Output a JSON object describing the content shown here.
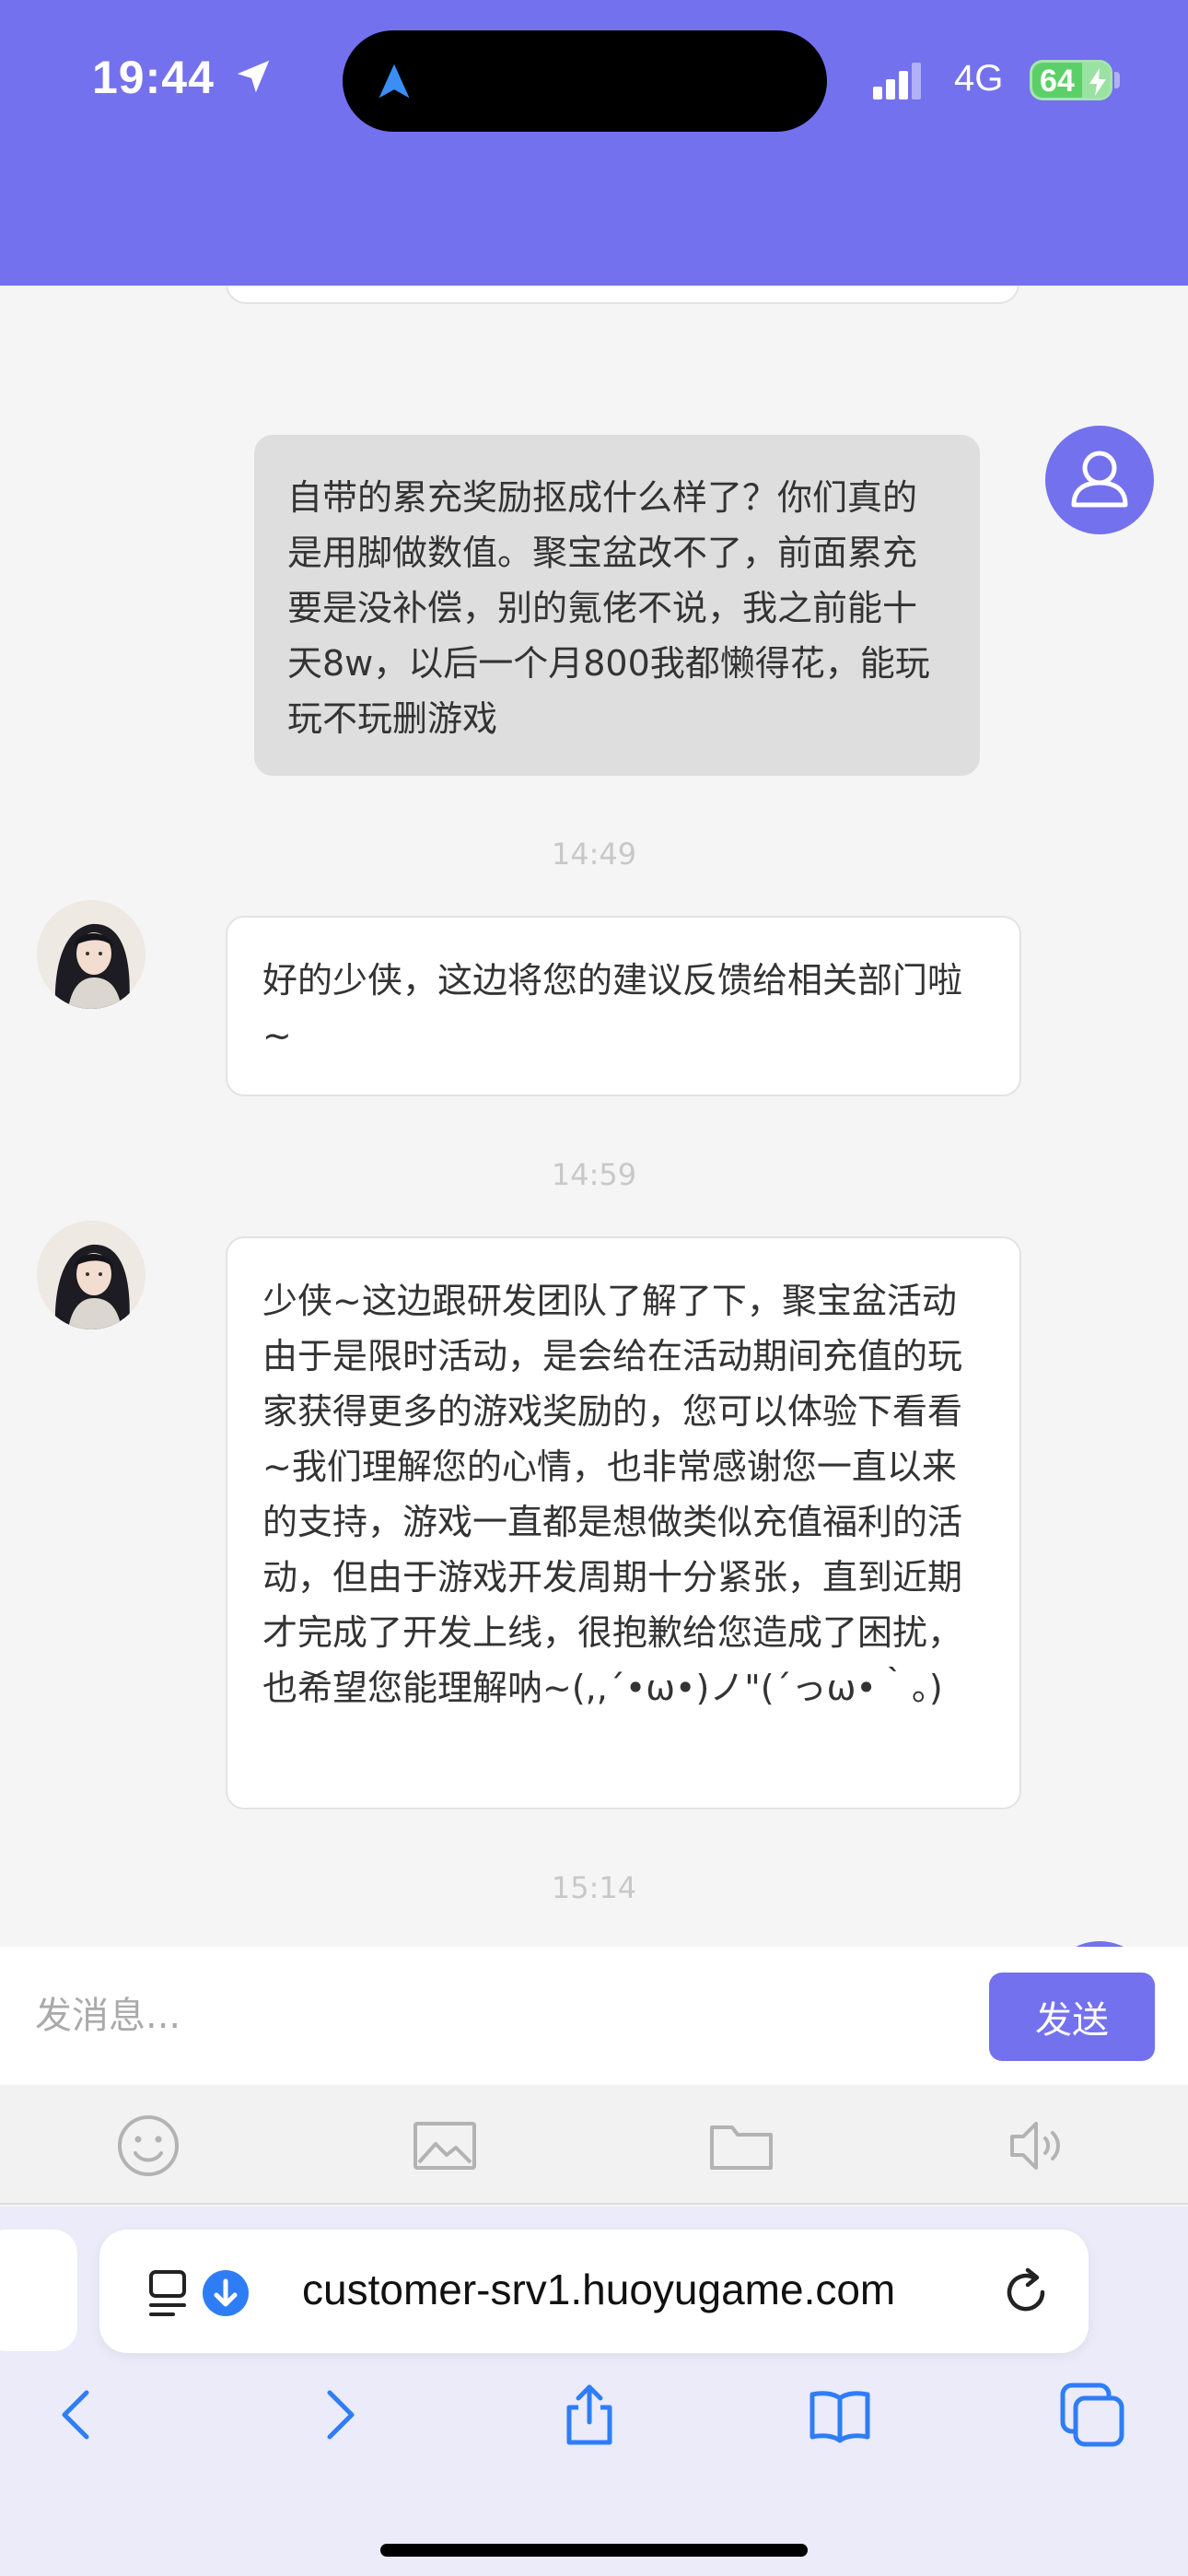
{
  "status_bar": {
    "time": "19:44",
    "network": "4G",
    "battery": "64"
  },
  "chat": {
    "messages": [
      {
        "sender": "user",
        "text": "自带的累充奖励抠成什么样了？你们真的是用脚做数值。聚宝盆改不了，前面累充要是没补偿，别的氪佬不说，我之前能十天8w，以后一个月800我都懒得花，能玩玩不玩删游戏"
      },
      {
        "type": "timestamp",
        "text": "14:49"
      },
      {
        "sender": "agent",
        "text": "好的少侠，这边将您的建议反馈给相关部门啦~"
      },
      {
        "type": "timestamp",
        "text": "14:59"
      },
      {
        "sender": "agent",
        "text": "少侠~这边跟研发团队了解了下，聚宝盆活动由于是限时活动，是会给在活动期间充值的玩家获得更多的游戏奖励的，您可以体验下看看~我们理解您的心情，也非常感谢您一直以来的支持，游戏一直都是想做类似充值福利的活动，但由于游戏开发周期十分紧张，直到近期才完成了开发上线，很抱歉给您造成了困扰，也希望您能理解呐~(,,´•ω•)ノ\"(´っω•｀。)"
      },
      {
        "type": "timestamp",
        "text": "15:14"
      }
    ]
  },
  "input": {
    "placeholder": "发消息...",
    "send_label": "发送"
  },
  "toolbar": {
    "icons": [
      "emoji-icon",
      "image-icon",
      "folder-icon",
      "voice-icon"
    ]
  },
  "browser": {
    "url": "customer-srv1.huoyugame.com"
  },
  "colors": {
    "accent": "#7371ee",
    "user_bubble": "#dedede",
    "agent_bubble": "#ffffff",
    "timestamp": "#c8c8c8",
    "safari_blue": "#2f7df6",
    "battery_green": "#5cd068"
  }
}
